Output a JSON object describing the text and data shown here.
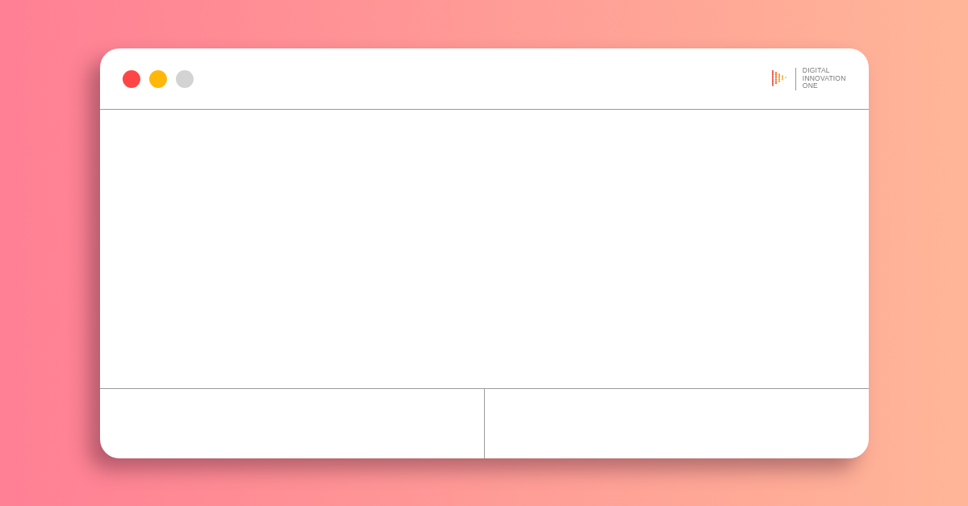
{
  "window_controls": [
    {
      "color": "#ff4646"
    },
    {
      "color": "#ffb80a"
    },
    {
      "color": "#d3d3d3"
    }
  ],
  "logo": {
    "lines": [
      "DIGITAL",
      "INNOVATION",
      "ONE"
    ]
  }
}
